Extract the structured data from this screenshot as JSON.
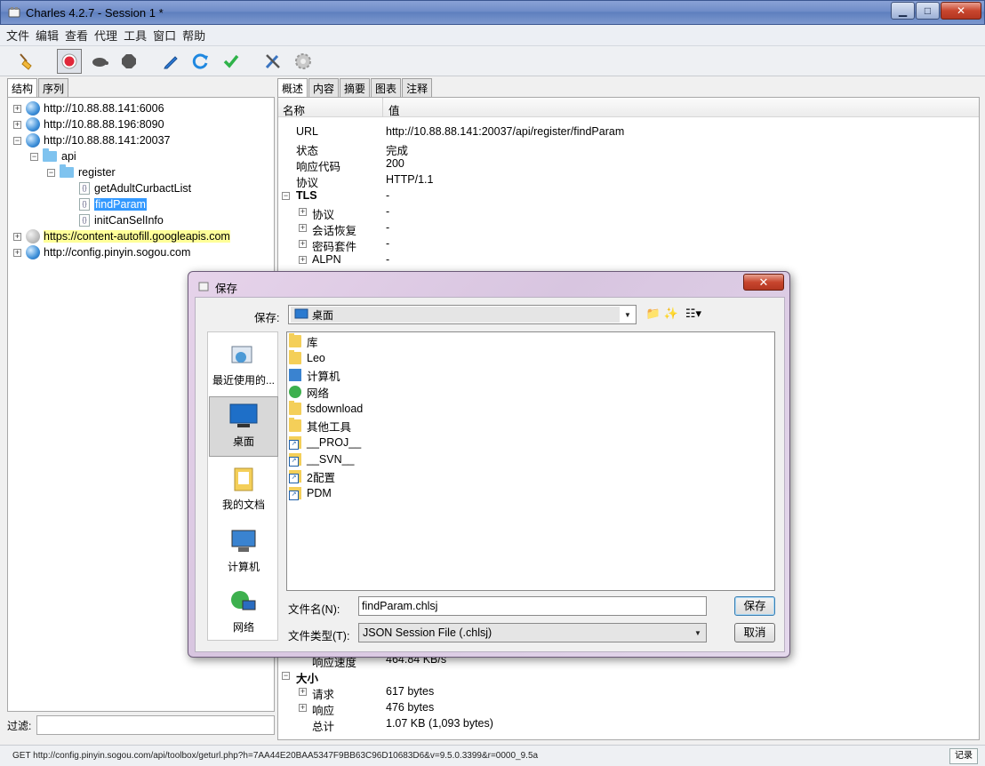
{
  "window": {
    "title": "Charles 4.2.7 - Session 1 *",
    "minimize": "▁",
    "maximize": "□",
    "close": "✕"
  },
  "menu": [
    "文件",
    "编辑",
    "查看",
    "代理",
    "工具",
    "窗口",
    "帮助"
  ],
  "toolbar": [
    "broom-icon",
    "record-icon",
    "turtle-icon",
    "stop-icon",
    "pencil-icon",
    "refresh-icon",
    "check-icon",
    "tools-icon",
    "gear-icon"
  ],
  "left": {
    "tabs": [
      "结构",
      "序列"
    ],
    "tree": {
      "host1": "http://10.88.88.141:6006",
      "host2": "http://10.88.88.196:8090",
      "host3": "http://10.88.88.141:20037",
      "api": "api",
      "register": "register",
      "file1": "getAdultCurbactList",
      "file2": "findParam",
      "file3": "initCanSelInfo",
      "host4": "https://content-autofill.googleapis.com",
      "host5": "http://config.pinyin.sogou.com"
    },
    "filter_label": "过滤:"
  },
  "right": {
    "tabs": [
      "概述",
      "内容",
      "摘要",
      "图表",
      "注释"
    ],
    "header": {
      "name": "名称",
      "value": "值"
    },
    "rows": {
      "url_k": "URL",
      "url_v": "http://10.88.88.141:20037/api/register/findParam",
      "status_k": "状态",
      "status_v": "完成",
      "code_k": "响应代码",
      "code_v": "200",
      "proto_k": "协议",
      "proto_v": "HTTP/1.1",
      "tls_k": "TLS",
      "tls_v": "-",
      "tls_proto_k": "协议",
      "tls_proto_v": "-",
      "session_k": "会话恢复",
      "session_v": "-",
      "cipher_k": "密码套件",
      "cipher_v": "-",
      "alpn_k": "ALPN",
      "alpn_v": "-",
      "speed_k": "响应速度",
      "speed_v": "464.84 KB/s",
      "size_k": "大小",
      "req_k": "请求",
      "req_v": "617 bytes",
      "resp_k": "响应",
      "resp_v": "476 bytes",
      "total_k": "总计",
      "total_v": "1.07 KB (1,093 bytes)"
    }
  },
  "status": {
    "text": "GET http://config.pinyin.sogou.com/api/toolbox/geturl.php?h=7AA44E20BAA5347F9BB63C96D10683D6&v=9.5.0.3399&r=0000_9.5a",
    "record": "记录"
  },
  "dialog": {
    "title": "保存",
    "close": "✕",
    "save_in_label": "保存:",
    "save_in_value": "桌面",
    "places": [
      "最近使用的...",
      "桌面",
      "我的文档",
      "计算机",
      "网络"
    ],
    "files": [
      "库",
      "Leo",
      "计算机",
      "网络",
      "fsdownload",
      "其他工具",
      "__PROJ__",
      "__SVN__",
      "2配置",
      "PDM"
    ],
    "filename_label": "文件名(N):",
    "filename_value": "findParam.chlsj",
    "filetype_label": "文件类型(T):",
    "filetype_value": "JSON Session File (.chlsj)",
    "save_btn": "保存",
    "cancel_btn": "取消"
  }
}
